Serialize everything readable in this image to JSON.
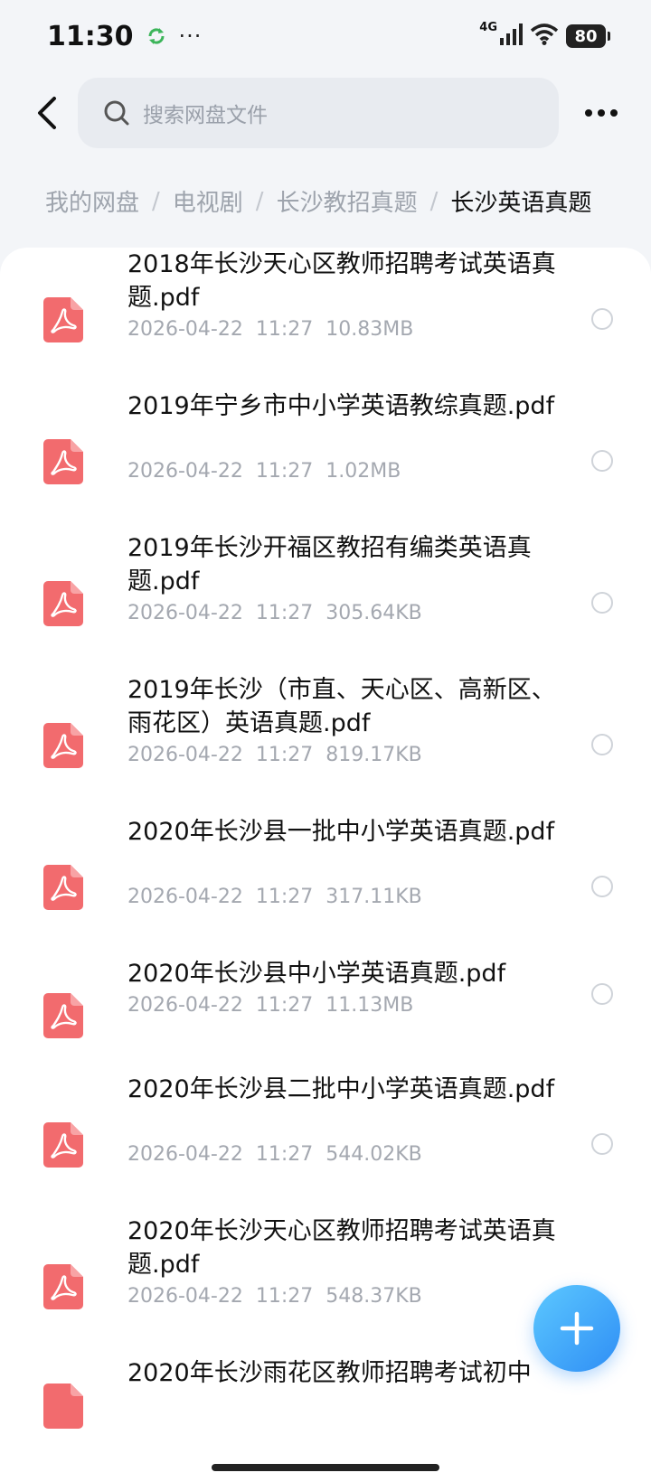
{
  "status_bar": {
    "time": "11:30",
    "dots": "···",
    "network": "4G",
    "battery": "80"
  },
  "search": {
    "placeholder": "搜索网盘文件"
  },
  "breadcrumb": {
    "items": [
      "我的网盘",
      "电视剧",
      "长沙教招真题",
      "长沙英语真题"
    ],
    "separator": "/"
  },
  "files": [
    {
      "name": "2018年长沙天心区教师招聘考试英语真题.pdf",
      "date": "2026-04-22",
      "time": "11:27",
      "size": "10.83MB",
      "icon": "pdf-icon"
    },
    {
      "name": "2019年宁乡市中小学英语教综真题.pdf",
      "date": "2026-04-22",
      "time": "11:27",
      "size": "1.02MB",
      "icon": "pdf-icon"
    },
    {
      "name": "2019年长沙开福区教招有编类英语真题.pdf",
      "date": "2026-04-22",
      "time": "11:27",
      "size": "305.64KB",
      "icon": "pdf-icon"
    },
    {
      "name": "2019年长沙（市直、天心区、高新区、雨花区）英语真题.pdf",
      "date": "2026-04-22",
      "time": "11:27",
      "size": "819.17KB",
      "icon": "pdf-icon"
    },
    {
      "name": "2020年长沙县一批中小学英语真题.pdf",
      "date": "2026-04-22",
      "time": "11:27",
      "size": "317.11KB",
      "icon": "pdf-icon"
    },
    {
      "name": "2020年长沙县中小学英语真题.pdf",
      "date": "2026-04-22",
      "time": "11:27",
      "size": "11.13MB",
      "icon": "pdf-icon"
    },
    {
      "name": "2020年长沙县二批中小学英语真题.pdf",
      "date": "2026-04-22",
      "time": "11:27",
      "size": "544.02KB",
      "icon": "pdf-icon"
    },
    {
      "name": "2020年长沙天心区教师招聘考试英语真题.pdf",
      "date": "2026-04-22",
      "time": "11:27",
      "size": "548.37KB",
      "icon": "pdf-icon"
    },
    {
      "name": "2020年长沙雨花区教师招聘考试初中",
      "date": "",
      "time": "",
      "size": "",
      "icon": "pdf-icon"
    }
  ],
  "colors": {
    "pdf_icon": "#f26b6e",
    "fab_gradient_start": "#5cc8ff",
    "fab_gradient_end": "#2f8ef5"
  },
  "icons": {
    "back": "chevron-left-icon",
    "search": "search-icon",
    "more": "more-horizontal-icon",
    "fab": "plus-icon",
    "sync": "sync-icon",
    "signal": "signal-icon",
    "wifi": "wifi-icon"
  }
}
